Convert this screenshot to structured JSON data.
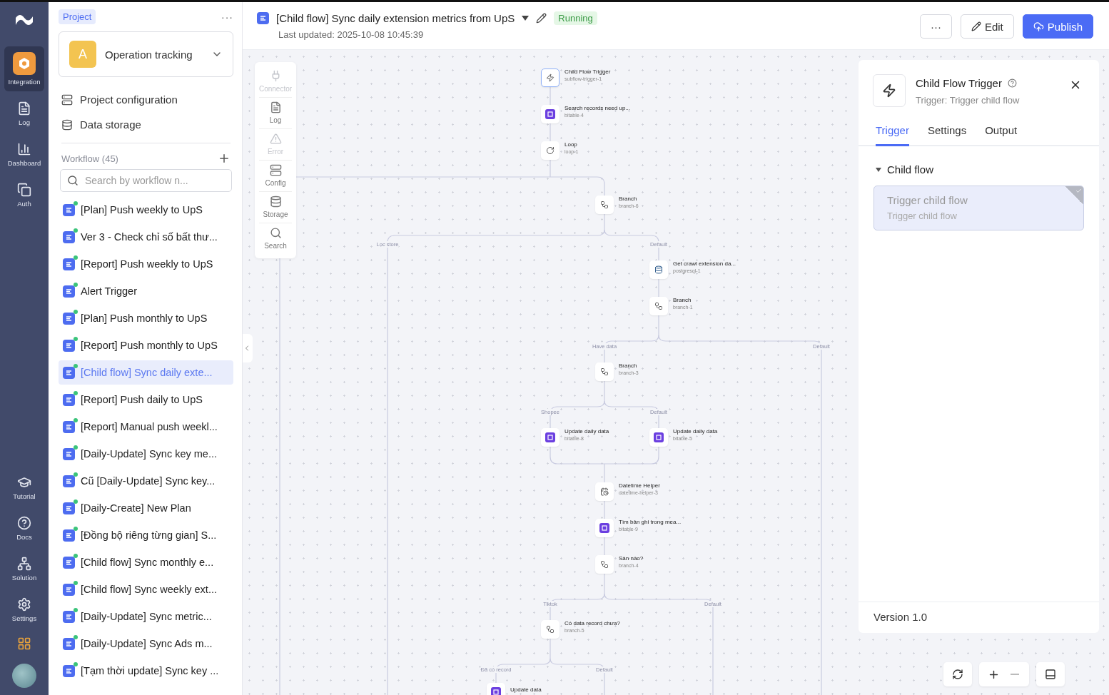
{
  "rail": {
    "items": [
      {
        "label": "Integration",
        "kind": "integration",
        "selected": true
      },
      {
        "label": "Log",
        "kind": "log",
        "selected": false
      },
      {
        "label": "Dashboard",
        "kind": "dashboard",
        "selected": false
      },
      {
        "label": "Auth",
        "kind": "auth",
        "selected": false
      }
    ],
    "bottom_items": [
      {
        "label": "Tutorial",
        "kind": "tutorial"
      },
      {
        "label": "Docs",
        "kind": "docs"
      },
      {
        "label": "Solution",
        "kind": "solution"
      },
      {
        "label": "Settings",
        "kind": "settings"
      }
    ]
  },
  "sidebar": {
    "badge": "Project",
    "more": "···",
    "project": {
      "initial": "A",
      "name": "Operation tracking"
    },
    "links": [
      {
        "label": "Project configuration",
        "kind": "config"
      },
      {
        "label": "Data storage",
        "kind": "storage"
      }
    ],
    "workflow_header": "Workflow (45)",
    "search": {
      "placeholder": "Search by workflow n..."
    },
    "workflows": [
      {
        "label": "[Plan] Push weekly to UpS",
        "selected": false
      },
      {
        "label": "Ver 3 - Check chỉ số bất thư...",
        "selected": false
      },
      {
        "label": "[Report] Push weekly to UpS",
        "selected": false
      },
      {
        "label": "Alert Trigger",
        "selected": false
      },
      {
        "label": "[Plan] Push monthly to UpS",
        "selected": false
      },
      {
        "label": "[Report] Push monthly to UpS",
        "selected": false
      },
      {
        "label": "[Child flow] Sync daily exte...",
        "selected": true
      },
      {
        "label": "[Report] Push daily to UpS",
        "selected": false
      },
      {
        "label": "[Report] Manual push weekl...",
        "selected": false
      },
      {
        "label": "[Daily-Update] Sync key me...",
        "selected": false
      },
      {
        "label": "Cũ [Daily-Update] Sync key...",
        "selected": false
      },
      {
        "label": "[Daily-Create] New Plan",
        "selected": false
      },
      {
        "label": "[Đồng bộ riêng từng gian] S...",
        "selected": false
      },
      {
        "label": "[Child flow] Sync monthly e...",
        "selected": false
      },
      {
        "label": "[Child flow] Sync weekly ext...",
        "selected": false
      },
      {
        "label": "[Daily-Update] Sync metric...",
        "selected": false
      },
      {
        "label": "[Daily-Update] Sync Ads m...",
        "selected": false
      },
      {
        "label": "[Tạm thời update] Sync key ...",
        "selected": false
      }
    ]
  },
  "header": {
    "title": "[Child flow] Sync daily extension metrics from UpS",
    "status": "Running",
    "updated": "Last updated: 2025-10-08 10:45:39",
    "more": "···",
    "edit": "Edit",
    "publish": "Publish"
  },
  "palette": [
    {
      "label": "Connector",
      "kind": "connector",
      "disabled": true
    },
    {
      "label": "Log",
      "kind": "log",
      "disabled": false
    },
    {
      "label": "Error",
      "kind": "error",
      "disabled": true
    },
    {
      "label": "Config",
      "kind": "config",
      "disabled": false
    },
    {
      "label": "Storage",
      "kind": "storage",
      "disabled": false
    },
    {
      "label": "Search",
      "kind": "search",
      "disabled": false
    }
  ],
  "nodes": [
    {
      "title": "Child Flow Trigger",
      "id": "subflow-trigger-1",
      "kind": "trigger",
      "selected": true
    },
    {
      "title": "Search records need up...",
      "id": "bitable-4",
      "kind": "bitable",
      "selected": false
    },
    {
      "title": "Loop",
      "id": "loop-1",
      "kind": "loop",
      "selected": false
    },
    {
      "title": "Branch",
      "id": "branch-6",
      "kind": "branch",
      "selected": false
    },
    {
      "title": "Get crawl extension da...",
      "id": "postgresql-1",
      "kind": "postgres",
      "selected": false
    },
    {
      "title": "Branch",
      "id": "branch-1",
      "kind": "branch",
      "selected": false
    },
    {
      "title": "Branch",
      "id": "branch-3",
      "kind": "branch",
      "selected": false
    },
    {
      "title": "Update daily data",
      "id": "bitable-8",
      "kind": "bitable",
      "selected": false
    },
    {
      "title": "Update daily data",
      "id": "bitable-5",
      "kind": "bitable",
      "selected": false
    },
    {
      "title": "Datetime Helper",
      "id": "datetime-helper-3",
      "kind": "datetime",
      "selected": false
    },
    {
      "title": "Tìm bản ghi trong mea...",
      "id": "bitable-9",
      "kind": "bitable",
      "selected": false
    },
    {
      "title": "Sàn nào?",
      "id": "branch-4",
      "kind": "branch",
      "selected": false
    },
    {
      "title": "Có data record chưa?",
      "id": "branch-5",
      "kind": "branch",
      "selected": false
    },
    {
      "title": "Update data",
      "kind": "bitable",
      "selected": false
    }
  ],
  "edge_labels": [
    "Lọc store",
    "Default",
    "Have data",
    "Default",
    "Shopee",
    "Default",
    "Tiktok",
    "Default",
    "Đã có record",
    "Default"
  ],
  "panel": {
    "title": "Child Flow Trigger",
    "subtitle": "Trigger: Trigger child flow",
    "tabs": [
      {
        "label": "Trigger",
        "selected": true
      },
      {
        "label": "Settings",
        "selected": false
      },
      {
        "label": "Output",
        "selected": false
      }
    ],
    "section": {
      "title": "Child flow",
      "expanded": true
    },
    "options": [
      {
        "title": "Trigger child flow",
        "description": "Trigger child flow",
        "selected": true
      }
    ],
    "version": "Version 1.0"
  }
}
